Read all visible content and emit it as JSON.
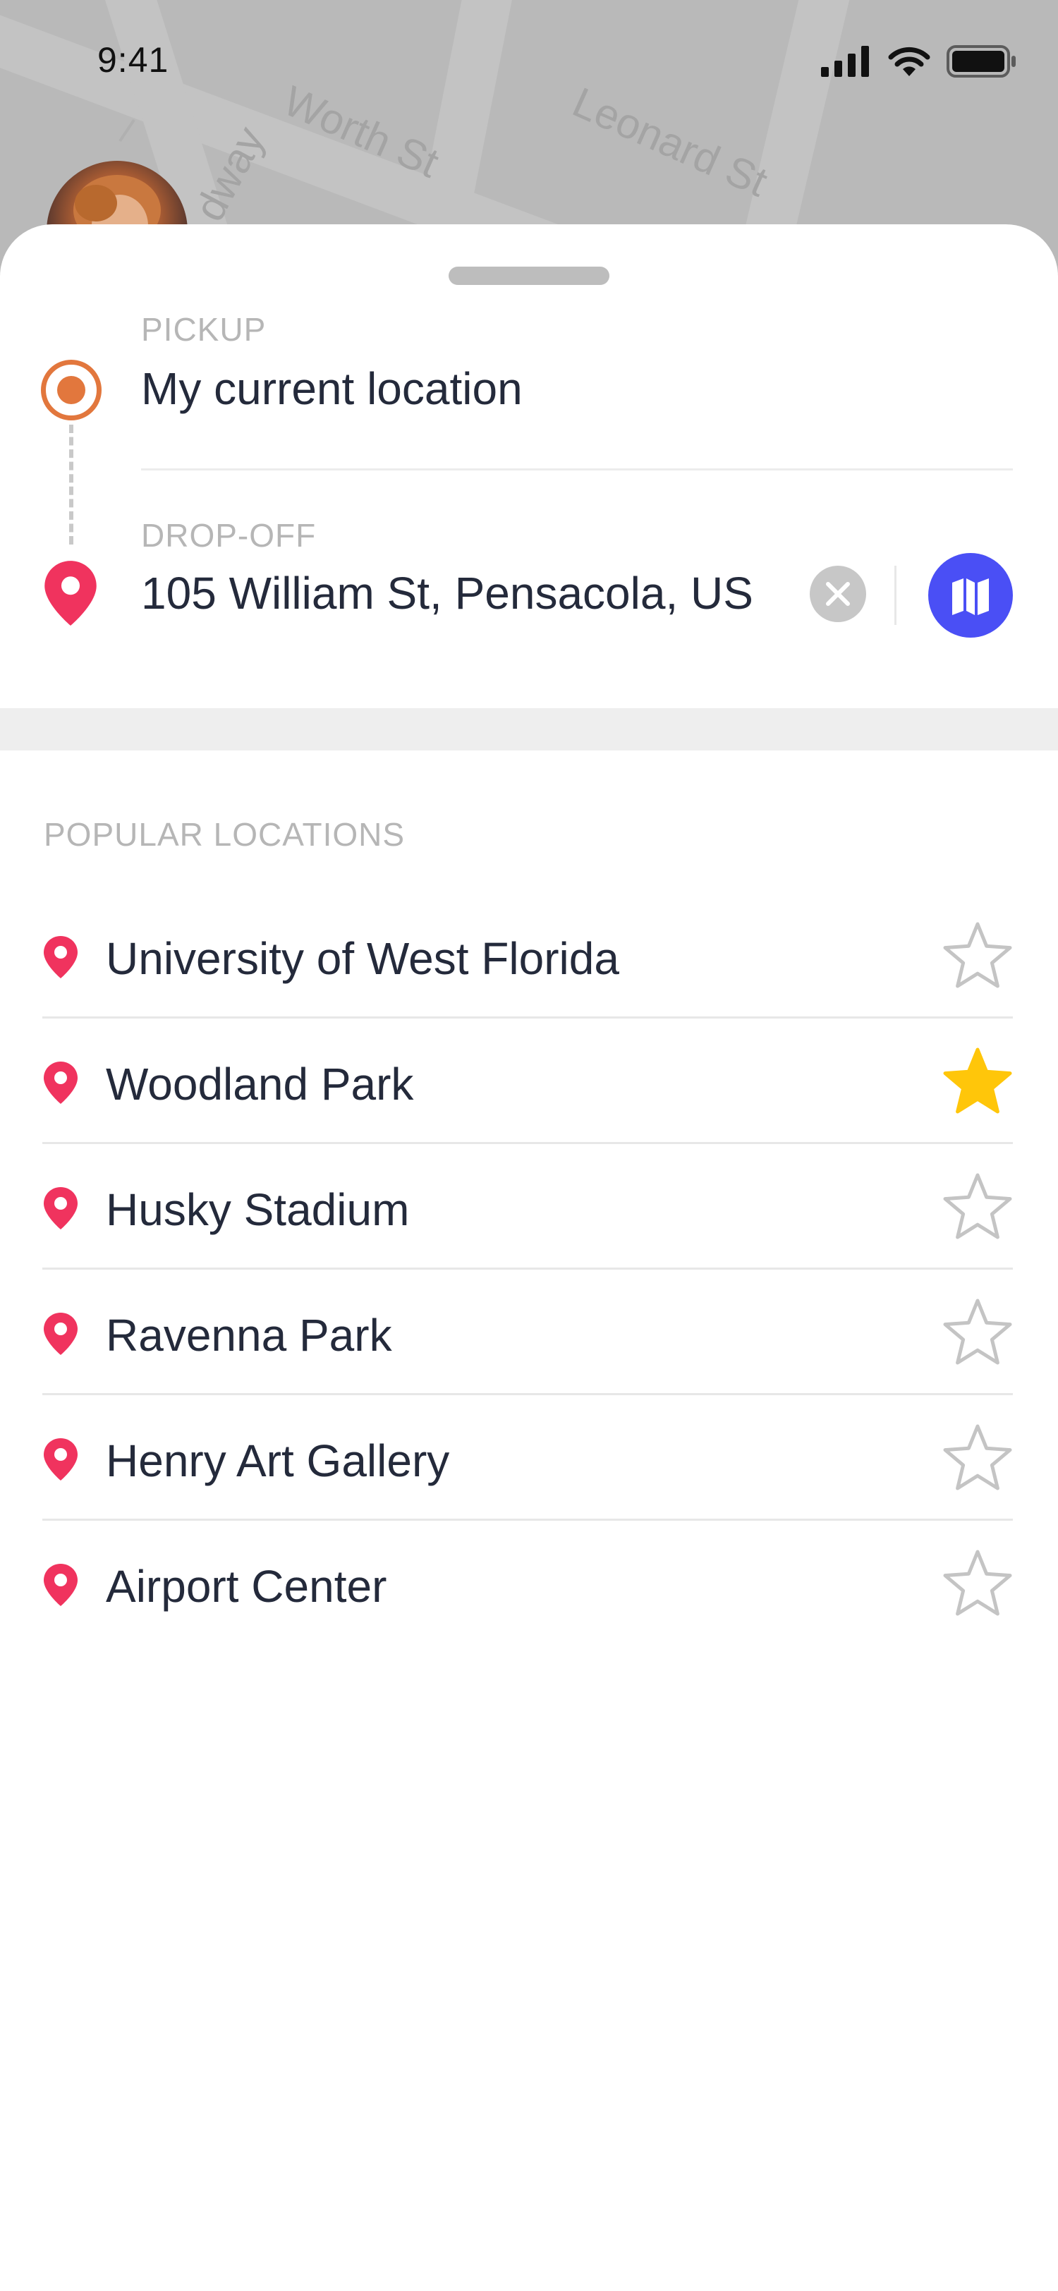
{
  "status_bar": {
    "time": "9:41"
  },
  "map": {
    "street_labels": [
      "Worth St",
      "Leonard St",
      "dway"
    ]
  },
  "trip": {
    "pickup_label": "PICKUP",
    "pickup_value": "My current location",
    "dropoff_label": "DROP-OFF",
    "dropoff_value": "105 William St, Pensacola, US"
  },
  "popular": {
    "title": "POPULAR LOCATIONS",
    "items": [
      {
        "name": "University of West Florida",
        "favorite": false
      },
      {
        "name": "Woodland Park",
        "favorite": true
      },
      {
        "name": "Husky Stadium",
        "favorite": false
      },
      {
        "name": "Ravenna Park",
        "favorite": false
      },
      {
        "name": "Henry Art Gallery",
        "favorite": false
      },
      {
        "name": "Airport Center",
        "favorite": false
      }
    ]
  },
  "colors": {
    "accent": "#4a4ff5",
    "pin": "#f0335e",
    "pickup": "#e2773d",
    "star_active": "#ffc60a",
    "star_inactive": "#c4c4c4",
    "text": "#242a3b"
  },
  "icons": {
    "signal": "cellular-signal-icon",
    "wifi": "wifi-icon",
    "battery": "battery-icon",
    "pickup": "pickup-dot-icon",
    "dropoff": "location-pin-icon",
    "clear": "close-icon",
    "map": "map-icon",
    "favorite": "star-icon"
  }
}
